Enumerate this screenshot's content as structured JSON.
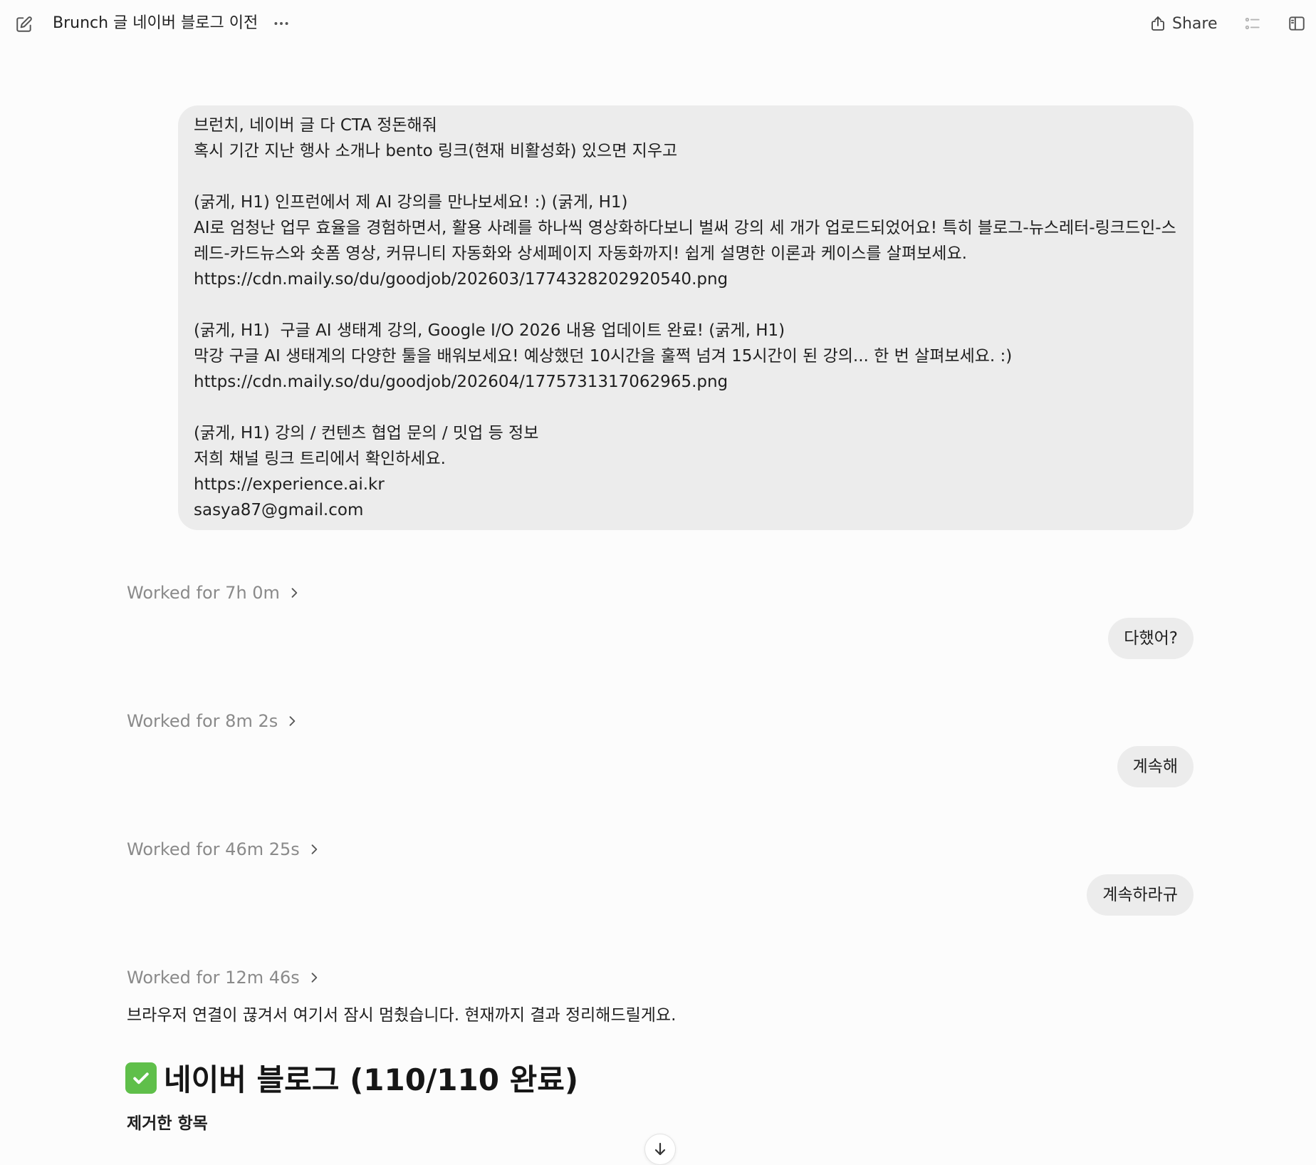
{
  "header": {
    "title": "Brunch 글 네이버 블로그 이전",
    "share_label": "Share",
    "icons": {
      "new_chat": "edit-icon",
      "more": "ellipsis-icon",
      "share": "share-icon",
      "list": "list-icon",
      "panel": "sidebar-panel-icon"
    }
  },
  "conversation": {
    "first_user_message": {
      "lines": [
        "브런치, 네이버 글 다 CTA 정돈해줘",
        "혹시 기간 지난 행사 소개나 bento 링크(현재 비활성화) 있으면 지우고",
        "",
        "(굵게, H1) 인프런에서 제 AI 강의를 만나보세요! :) (굵게, H1)",
        "AI로 엄청난 업무 효율을 경험하면서, 활용 사례를 하나씩 영상화하다보니 벌써 강의 세 개가 업로드되었어요! 특히 블로그-뉴스레터-링크드인-스레드-카드뉴스와 숏폼 영상, 커뮤니티 자동화와 상세페이지 자동화까지! 쉽게 설명한 이론과 케이스를 살펴보세요.",
        "https://cdn.maily.so/du/goodjob/202603/1774328202920540.png",
        "",
        "(굵게, H1)  구글 AI 생태계 강의, Google I/O 2026 내용 업데이트 완료! (굵게, H1)",
        "막강 구글 AI 생태계의 다양한 툴을 배워보세요! 예상했던 10시간을 훌쩍 넘겨 15시간이 된 강의... 한 번 살펴보세요. :)",
        "https://cdn.maily.so/du/goodjob/202604/1775731317062965.png",
        "",
        "(굵게, H1) 강의 / 컨텐츠 협업 문의 / 밋업 등 정보",
        "저희 채널 링크 트리에서 확인하세요.",
        "https://experience.ai.kr",
        "sasya87@gmail.com"
      ]
    },
    "worked": [
      {
        "label": "Worked for 7h 0m"
      },
      {
        "label": "Worked for 8m 2s"
      },
      {
        "label": "Worked for 46m 25s"
      },
      {
        "label": "Worked for 12m 46s"
      }
    ],
    "short_user_messages": [
      {
        "text": "다했어?"
      },
      {
        "text": "계속해"
      },
      {
        "text": "계속하라규"
      }
    ],
    "assistant": {
      "paragraph": "브라우저 연결이 끊겨서 여기서 잠시 멈췄습니다. 현재까지 결과 정리해드릴게요.",
      "heading": "네이버 블로그 (110/110 완료)",
      "heading_icon": "checkmark-box-icon",
      "subheading": "제거한 항목"
    },
    "scroll_down_icon": "arrow-down-icon"
  },
  "colors": {
    "background": "#fcfcfc",
    "bubble": "#ececec",
    "muted_text": "#8a8a8a",
    "check_green": "#5fbf4a"
  }
}
